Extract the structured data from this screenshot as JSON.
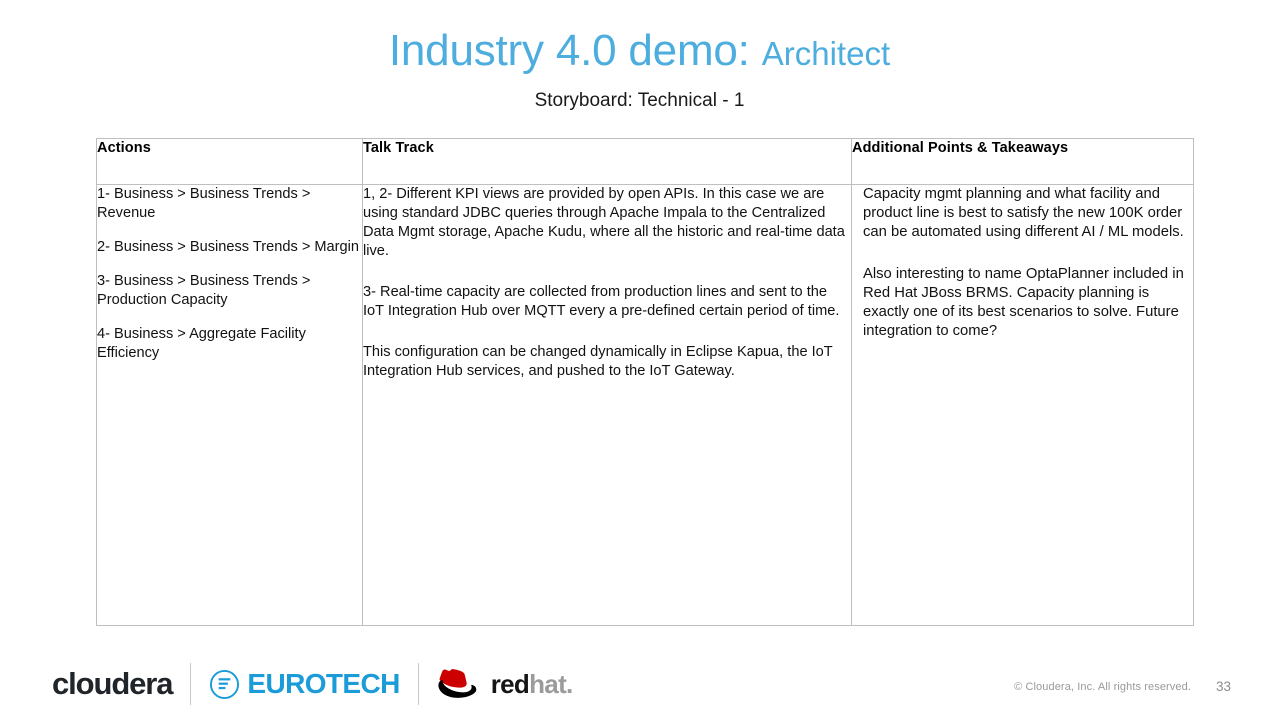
{
  "slide": {
    "title_main": "Industry 4.0 demo:",
    "title_accent": "Architect",
    "subtitle": "Storyboard: Technical - 1",
    "title_color": "#4CADDE"
  },
  "table": {
    "headers": [
      "Actions",
      "Talk Track",
      "Additional Points & Takeaways"
    ],
    "columns": {
      "actions": [
        "1- Business > Business Trends > Revenue",
        "2- Business > Business Trends > Margin",
        "3- Business > Business Trends > Production Capacity",
        "4- Business > Aggregate Facility Efficiency"
      ],
      "talk_track": [
        "1, 2- Different KPI views are provided by open APIs. In this case we are using standard JDBC queries through Apache Impala to the Centralized Data Mgmt storage, Apache Kudu, where all the historic and real-time data live.",
        "3- Real-time capacity are collected from production lines and sent to the IoT Integration Hub over MQTT every a pre-defined certain period of time.",
        "This configuration can be changed dynamically in Eclipse Kapua, the IoT Integration Hub services, and pushed to the IoT Gateway."
      ],
      "additional_points": [
        "Capacity mgmt planning and what facility and product line is best to satisfy the new 100K order can be automated using different AI / ML models.",
        "Also interesting to name OptaPlanner included in Red Hat JBoss BRMS. Capacity planning is exactly one of its best scenarios to solve. Future integration to come?"
      ]
    }
  },
  "footer": {
    "logos": {
      "cloudera": "cloudera",
      "eurotech": "EUROTECH",
      "redhat_bold": "red",
      "redhat_light": "hat.",
      "eurotech_color": "#1B9CD9",
      "redhat_color": "#CC0000"
    },
    "copyright": "© Cloudera, Inc. All rights reserved.",
    "page_number": "33"
  }
}
